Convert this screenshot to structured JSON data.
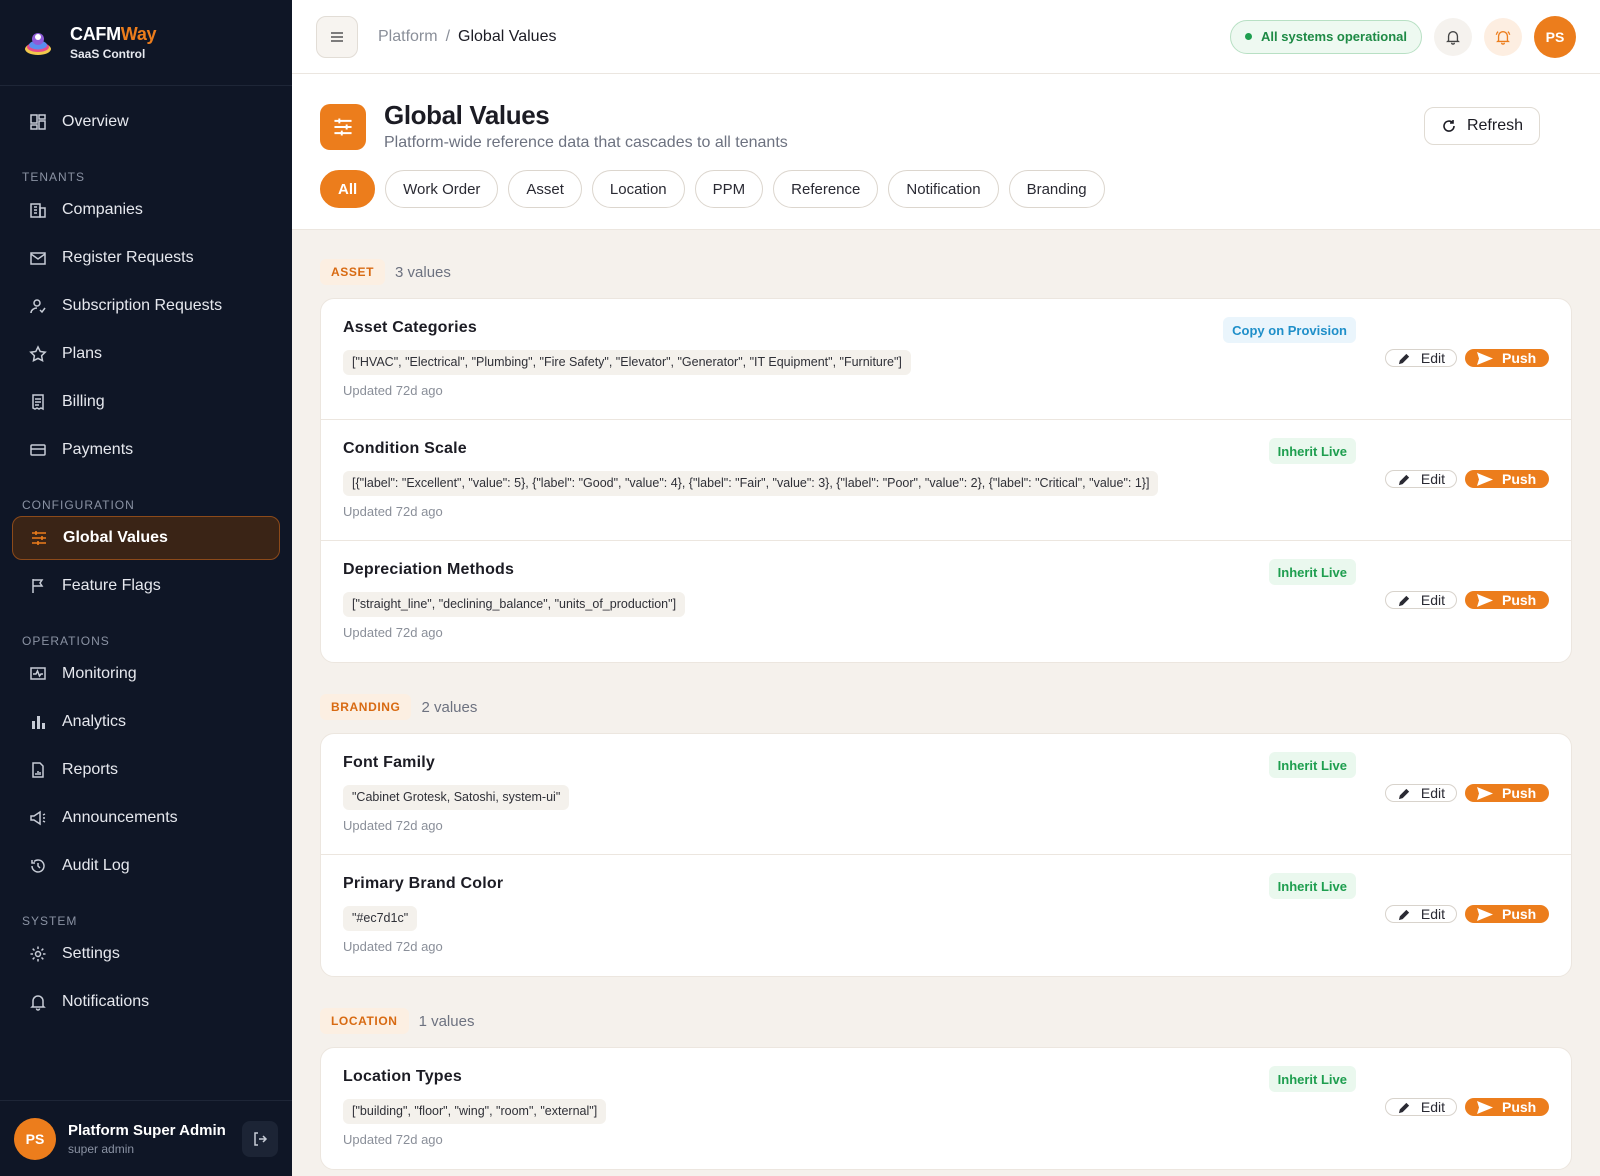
{
  "brand": {
    "name_main": "CAFM",
    "name_accent": "Way",
    "subtitle": "SaaS Control"
  },
  "nav": {
    "overview": "Overview",
    "sections": {
      "tenants": "TENANTS",
      "configuration": "CONFIGURATION",
      "operations": "OPERATIONS",
      "system": "SYSTEM"
    },
    "items": {
      "companies": "Companies",
      "register_requests": "Register Requests",
      "subscription_requests": "Subscription Requests",
      "plans": "Plans",
      "billing": "Billing",
      "payments": "Payments",
      "global_values": "Global Values",
      "feature_flags": "Feature Flags",
      "monitoring": "Monitoring",
      "analytics": "Analytics",
      "reports": "Reports",
      "announcements": "Announcements",
      "audit_log": "Audit Log",
      "settings": "Settings",
      "notifications": "Notifications"
    }
  },
  "user": {
    "initials": "PS",
    "name": "Platform Super Admin",
    "role": "super admin"
  },
  "topbar": {
    "breadcrumb_root": "Platform",
    "breadcrumb_sep": "/",
    "breadcrumb_current": "Global Values",
    "status": "All systems operational",
    "avatar_initials": "PS"
  },
  "header": {
    "title": "Global Values",
    "subtitle": "Platform-wide reference data that cascades to all tenants",
    "refresh_label": "Refresh",
    "filters": [
      "All",
      "Work Order",
      "Asset",
      "Location",
      "PPM",
      "Reference",
      "Notification",
      "Branding"
    ]
  },
  "actions": {
    "edit_label": "Edit",
    "push_label": "Push"
  },
  "groups": [
    {
      "tag": "ASSET",
      "count": "3 values",
      "rows": [
        {
          "title": "Asset Categories",
          "value": "[\"HVAC\", \"Electrical\", \"Plumbing\", \"Fire Safety\", \"Elevator\", \"Generator\", \"IT Equipment\", \"Furniture\"]",
          "updated": "Updated 72d ago",
          "mode": "Copy on Provision"
        },
        {
          "title": "Condition Scale",
          "value": "[{\"label\": \"Excellent\", \"value\": 5}, {\"label\": \"Good\", \"value\": 4}, {\"label\": \"Fair\", \"value\": 3}, {\"label\": \"Poor\", \"value\": 2}, {\"label\": \"Critical\", \"value\": 1}]",
          "updated": "Updated 72d ago",
          "mode": "Inherit Live"
        },
        {
          "title": "Depreciation Methods",
          "value": "[\"straight_line\", \"declining_balance\", \"units_of_production\"]",
          "updated": "Updated 72d ago",
          "mode": "Inherit Live"
        }
      ]
    },
    {
      "tag": "BRANDING",
      "count": "2 values",
      "rows": [
        {
          "title": "Font Family",
          "value": "\"Cabinet Grotesk, Satoshi, system-ui\"",
          "updated": "Updated 72d ago",
          "mode": "Inherit Live"
        },
        {
          "title": "Primary Brand Color",
          "value": "\"#ec7d1c\"",
          "updated": "Updated 72d ago",
          "mode": "Inherit Live"
        }
      ]
    },
    {
      "tag": "LOCATION",
      "count": "1 values",
      "rows": [
        {
          "title": "Location Types",
          "value": "[\"building\", \"floor\", \"wing\", \"room\", \"external\"]",
          "updated": "Updated 72d ago",
          "mode": "Inherit Live"
        }
      ]
    }
  ],
  "colors": {
    "accent": "#ec7d1c",
    "sidebar": "#0f1626",
    "live": "#1e9e4f",
    "copy": "#1f8fc9"
  }
}
